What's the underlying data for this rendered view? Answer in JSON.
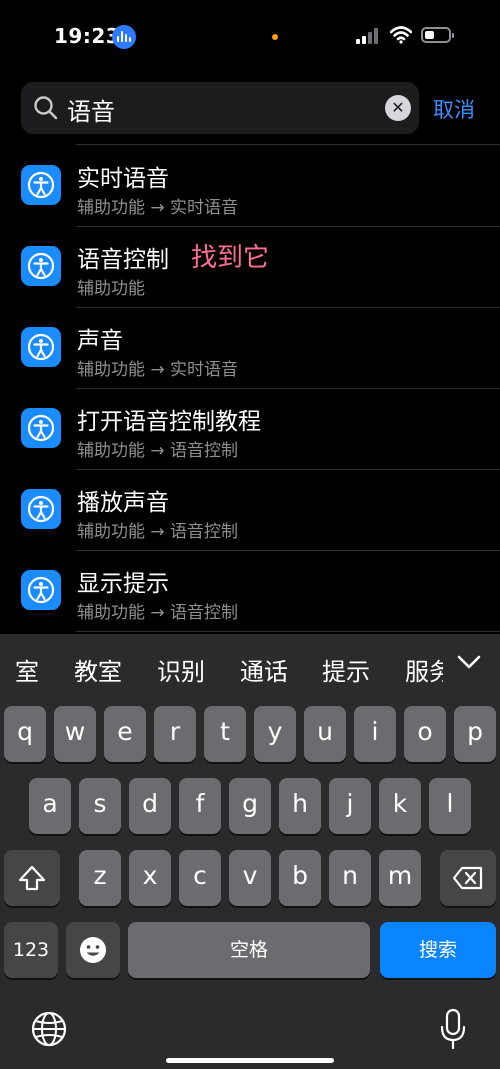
{
  "status": {
    "time": "19:23",
    "colors": {
      "voice_pill": "#2f7bff",
      "privacy_dot": "#ff9f0a"
    }
  },
  "search": {
    "query": "语音",
    "clear_icon": "clear-icon",
    "cancel_label": "取消",
    "accent": "#3a8eff"
  },
  "results": [
    {
      "title": "实时语音",
      "subtitle": "辅助功能 → 实时语音",
      "icon": "accessibility-icon"
    },
    {
      "title": "语音控制",
      "subtitle": "辅助功能",
      "icon": "accessibility-icon"
    },
    {
      "title": "声音",
      "subtitle": "辅助功能 → 实时语音",
      "icon": "accessibility-icon"
    },
    {
      "title": "打开语音控制教程",
      "subtitle": "辅助功能 → 语音控制",
      "icon": "accessibility-icon"
    },
    {
      "title": "播放声音",
      "subtitle": "辅助功能 → 语音控制",
      "icon": "accessibility-icon"
    },
    {
      "title": "显示提示",
      "subtitle": "辅助功能 → 语音控制",
      "icon": "accessibility-icon"
    }
  ],
  "annotation": "找到它",
  "keyboard": {
    "suggestions": [
      "室",
      "教室",
      "识别",
      "通话",
      "提示",
      "服务"
    ],
    "row1": [
      "q",
      "w",
      "e",
      "r",
      "t",
      "y",
      "u",
      "i",
      "o",
      "p"
    ],
    "row2": [
      "a",
      "s",
      "d",
      "f",
      "g",
      "h",
      "j",
      "k",
      "l"
    ],
    "row3": [
      "z",
      "x",
      "c",
      "v",
      "b",
      "n",
      "m"
    ],
    "numbers_label": "123",
    "space_label": "空格",
    "search_label": "搜索",
    "search_key_color": "#0a84ff"
  }
}
